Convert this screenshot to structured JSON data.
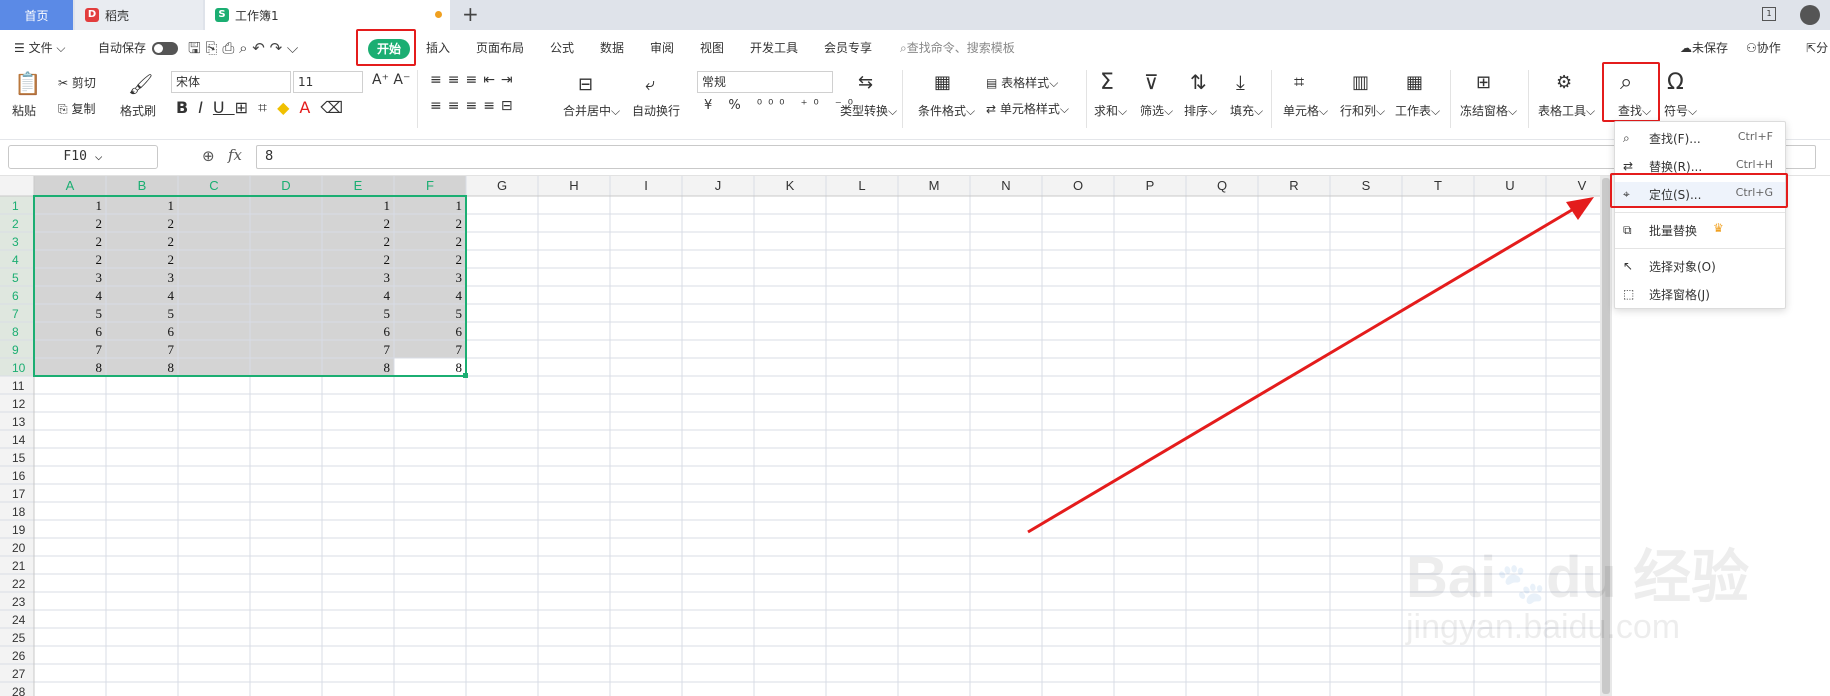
{
  "tabs": {
    "home": "首页",
    "daoke": "稻壳",
    "workbook": "工作簿1"
  },
  "menu": {
    "file": "文件",
    "autosave": "自动保存",
    "start": "开始",
    "insert": "插入",
    "layout": "页面布局",
    "formula": "公式",
    "data": "数据",
    "review": "审阅",
    "view": "视图",
    "dev": "开发工具",
    "vip": "会员专享",
    "search": "查找命令、搜索模板",
    "unsaved": "未保存",
    "collab": "协作",
    "share": "分"
  },
  "ribbon": {
    "paste": "粘贴",
    "cut": "剪切",
    "copy": "复制",
    "format_brush": "格式刷",
    "font": "宋体",
    "size": "11",
    "number_format": "常规",
    "merge": "合并居中",
    "wrap": "自动换行",
    "convert": "类型转换",
    "cond_format": "条件格式",
    "table_style": "表格样式",
    "cell_style": "单元格样式",
    "sum": "求和",
    "filter": "筛选",
    "sort": "排序",
    "fill": "填充",
    "cell": "单元格",
    "rowcol": "行和列",
    "sheet": "工作表",
    "freeze": "冻结窗格",
    "table_tools": "表格工具",
    "find": "查找",
    "symbol": "符号"
  },
  "formula_bar": {
    "name": "F10",
    "fx": "fx",
    "value": "8"
  },
  "dropdown": [
    {
      "label": "查找(F)...",
      "shortcut": "Ctrl+F",
      "icon": "search-icon"
    },
    {
      "label": "替换(R)...",
      "shortcut": "Ctrl+H",
      "icon": "replace-icon"
    },
    {
      "label": "定位(S)...",
      "shortcut": "Ctrl+G",
      "icon": "locate-icon"
    },
    {
      "label": "批量替换",
      "shortcut": "",
      "icon": "batch-replace-icon"
    },
    {
      "label": "选择对象(O)",
      "shortcut": "",
      "icon": "select-object-icon"
    },
    {
      "label": "选择窗格(J)",
      "shortcut": "",
      "icon": "selection-pane-icon"
    }
  ],
  "grid": {
    "columns": [
      "A",
      "B",
      "C",
      "D",
      "E",
      "F",
      "G",
      "H",
      "I",
      "J",
      "K",
      "L",
      "M",
      "N",
      "O",
      "P",
      "Q",
      "R",
      "S",
      "T",
      "U",
      "V"
    ],
    "rows": [
      "1",
      "2",
      "3",
      "4",
      "5",
      "6",
      "7",
      "8",
      "9",
      "10",
      "11",
      "12",
      "13",
      "14",
      "15",
      "16",
      "17",
      "18",
      "19",
      "20",
      "21",
      "22",
      "23",
      "24",
      "25",
      "26",
      "27",
      "28"
    ],
    "values": [
      [
        1,
        1,
        "",
        "",
        1,
        1
      ],
      [
        2,
        2,
        "",
        "",
        2,
        2
      ],
      [
        2,
        2,
        "",
        "",
        2,
        2
      ],
      [
        2,
        2,
        "",
        "",
        2,
        2
      ],
      [
        3,
        3,
        "",
        "",
        3,
        3
      ],
      [
        4,
        4,
        "",
        "",
        4,
        4
      ],
      [
        5,
        5,
        "",
        "",
        5,
        5
      ],
      [
        6,
        6,
        "",
        "",
        6,
        6
      ],
      [
        7,
        7,
        "",
        "",
        7,
        7
      ],
      [
        8,
        8,
        "",
        "",
        8,
        8
      ]
    ]
  },
  "watermark": {
    "brand": "Bai",
    "brand2": "du",
    "cn": "经验",
    "url": "jingyan.baidu.com"
  },
  "colors": {
    "accent": "#1bae72",
    "selection": "#d4d4d4",
    "highlight": "#e41c1c",
    "tab_active": "#5b8ae6"
  }
}
